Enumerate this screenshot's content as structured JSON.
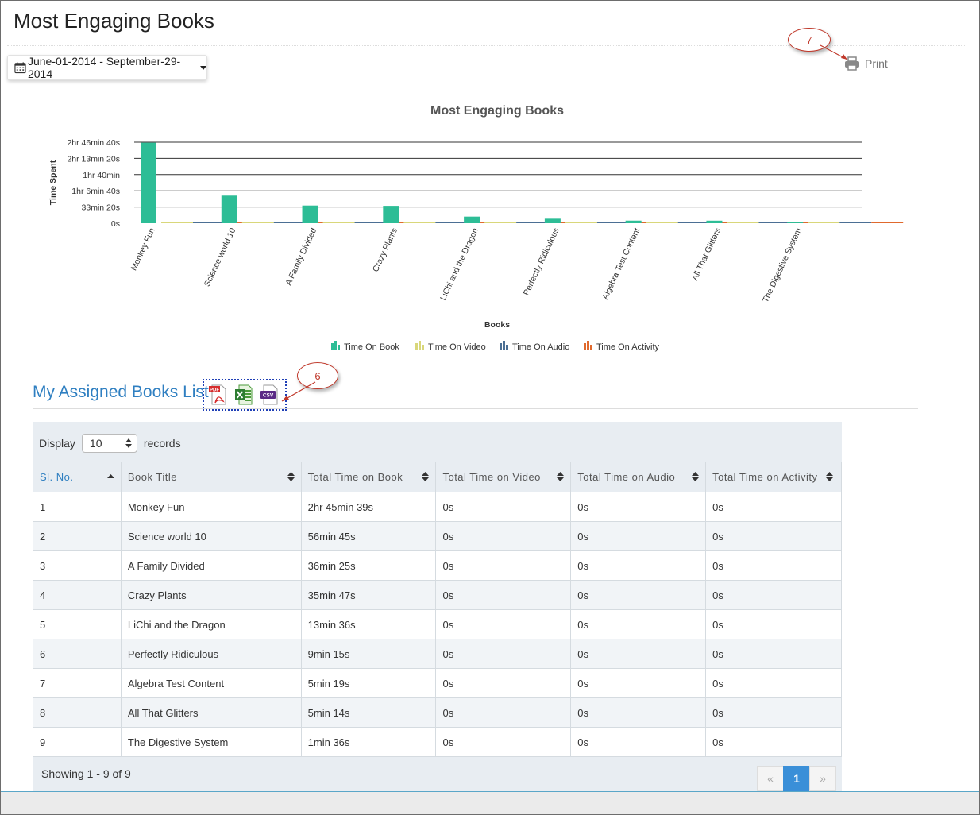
{
  "page_title": "Most Engaging Books",
  "date_range": "June-01-2014 - September-29-2014",
  "print_label": "Print",
  "callouts": {
    "print": "7",
    "export": "6"
  },
  "chart_data": {
    "type": "bar",
    "title": "Most Engaging Books",
    "xlabel": "Books",
    "ylabel": "Time Spent",
    "categories": [
      "Monkey Fun",
      "Science world 10",
      "A Family Divided",
      "Crazy Plants",
      "LiChi and the Dragon",
      "Perfectly Ridiculous",
      "Algebra Test Content",
      "All That Glitters",
      "The Digestive System"
    ],
    "ytick_labels": [
      "0s",
      "33min 20s",
      "1hr 6min 40s",
      "1hr 40min",
      "2hr 13min 20s",
      "2hr 46min 40s"
    ],
    "ytick_values": [
      0,
      2000,
      4000,
      6000,
      8000,
      10000
    ],
    "ylim": [
      0,
      10000
    ],
    "grid": true,
    "legend_position": "bottom",
    "series": [
      {
        "name": "Time On Book",
        "color": "#2dbd96",
        "values": [
          9939,
          3405,
          2185,
          2147,
          816,
          555,
          319,
          314,
          96
        ]
      },
      {
        "name": "Time On Video",
        "color": "#d9d77a",
        "values": [
          0,
          0,
          0,
          0,
          0,
          0,
          0,
          0,
          0
        ]
      },
      {
        "name": "Time On Audio",
        "color": "#4b6f94",
        "values": [
          0,
          0,
          0,
          0,
          0,
          0,
          0,
          0,
          0
        ]
      },
      {
        "name": "Time On Activity",
        "color": "#e0692d",
        "values": [
          0,
          0,
          0,
          0,
          0,
          0,
          0,
          0,
          0
        ]
      }
    ]
  },
  "section_title": "My Assigned Books List",
  "export_icons": [
    "pdf-icon",
    "excel-icon",
    "csv-icon"
  ],
  "export_labels": {
    "pdf": "PDF",
    "csv": "CSV"
  },
  "display": {
    "label": "Display",
    "value": "10",
    "suffix": "records"
  },
  "table": {
    "headers": [
      "Sl. No.",
      "Book Title",
      "Total Time on Book",
      "Total Time on Video",
      "Total Time on Audio",
      "Total Time on Activity"
    ],
    "rows": [
      [
        "1",
        "Monkey Fun",
        "2hr 45min 39s",
        "0s",
        "0s",
        "0s"
      ],
      [
        "2",
        "Science world 10",
        "56min 45s",
        "0s",
        "0s",
        "0s"
      ],
      [
        "3",
        "A Family Divided",
        "36min 25s",
        "0s",
        "0s",
        "0s"
      ],
      [
        "4",
        "Crazy Plants",
        "35min 47s",
        "0s",
        "0s",
        "0s"
      ],
      [
        "5",
        "LiChi and the Dragon",
        "13min 36s",
        "0s",
        "0s",
        "0s"
      ],
      [
        "6",
        "Perfectly Ridiculous",
        "9min 15s",
        "0s",
        "0s",
        "0s"
      ],
      [
        "7",
        "Algebra Test Content",
        "5min 19s",
        "0s",
        "0s",
        "0s"
      ],
      [
        "8",
        "All That Glitters",
        "5min 14s",
        "0s",
        "0s",
        "0s"
      ],
      [
        "9",
        "The Digestive System",
        "1min 36s",
        "0s",
        "0s",
        "0s"
      ]
    ]
  },
  "showing": "Showing 1 - 9 of 9",
  "pagination": {
    "prev": "«",
    "current": "1",
    "next": "»"
  }
}
